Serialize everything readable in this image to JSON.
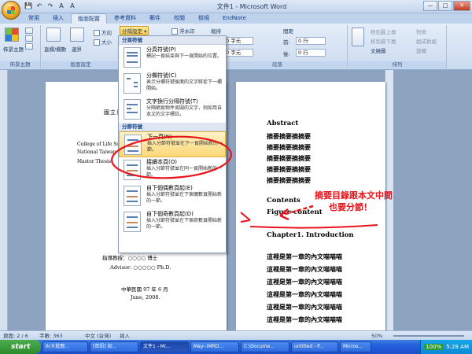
{
  "window": {
    "title": "文件1 - Microsoft Word",
    "controls": [
      "—",
      "□",
      "✕"
    ]
  },
  "quick_access": [
    "💾",
    "↶",
    "↷",
    "A",
    "A"
  ],
  "tabs": [
    "常用",
    "插入",
    "版面配置",
    "參考資料",
    "郵件",
    "校閱",
    "檢視",
    "EndNote"
  ],
  "active_tab": "版面配置",
  "ribbon": {
    "groups": {
      "theme": "佈景主題",
      "page_setup": "版面設定",
      "paragraph": "段落",
      "arrange": "排列"
    },
    "theme_button": "佈景主題",
    "margins_button": "邊界",
    "orientation_button": "方向",
    "size_button": "大小",
    "columns_button": "直欄/欄數",
    "breaks_button": "分隔設定",
    "watermark_button": "浮水印",
    "indent_label": "縮排",
    "spacing_label": "間距",
    "left_label": "左:",
    "right_label": "右:",
    "left_value": "0 字元",
    "right_value": "0 字元",
    "before_label": "前:",
    "after_label": "後:",
    "before_value": "0 行",
    "after_value": "0 行",
    "bring_front": "移到最上層",
    "send_back": "移到最下層",
    "text_wrap": "文繞圖",
    "align": "對齊",
    "group": "組成群組",
    "rotate": "旋轉"
  },
  "menu": {
    "section_page": "分頁符號",
    "section_break": "分節符號",
    "items": [
      {
        "title": "分頁符號(P)",
        "desc": "標記一頁結束與下一頁開始的位置。"
      },
      {
        "title": "分欄符號(C)",
        "desc": "表示分欄符號後面的文字將從下一欄開始。"
      },
      {
        "title": "文字換行分隔符號(T)",
        "desc": "分隔網頁物件周圍的文字，例如用自本文的文字標註。"
      },
      {
        "title": "下一頁(N)",
        "desc": "插入分節符號並在下一頁開始新的一節。"
      },
      {
        "title": "接續本頁(O)",
        "desc": "插入分節符號並在同一頁開始新的一節。"
      },
      {
        "title": "自下個偶數頁起(E)",
        "desc": "插入分節符號並在下個偶數頁開始新的一節。"
      },
      {
        "title": "自下個奇數頁起(D)",
        "desc": "插入分節符號並在下個奇數頁開始新的一節。"
      }
    ]
  },
  "left_page": {
    "university": "國立臺灣",
    "college": "College of Life Sc",
    "national": "National Taiwan",
    "thesis": "Master Thesis",
    "advisor_zh": "指導教授：○○○○ 博士",
    "advisor_en": "Advisor: ○○○○○ Ph.D.",
    "date_zh": "中華民國 97 年 6 月",
    "date_en": "June, 2008."
  },
  "right_page": {
    "abstract": "Abstract",
    "abstract_lines": [
      "摘要摘要摘摘要",
      "摘要摘要摘摘要",
      "摘要摘要摘摘要",
      "摘要摘要摘摘要",
      "摘要摘要摘摘要"
    ],
    "contents": "Contents",
    "figure_content": "Figure content",
    "chapter1": "Chapter1. Introduction",
    "chapter_lines": [
      "這裡是第一章的內文喵喵喵",
      "這裡是第一章的內文喵喵喵",
      "這裡是第一章的內文喵喵喵",
      "這裡是第一章的內文喵喵喵",
      "這裡是第一章的內文喵喵喵",
      "這裡是第一章的內文喵喵喵"
    ]
  },
  "annotation": {
    "line1": "摘要目錄跟本文中間",
    "line2": "也要分節！",
    "color": "#e8141c"
  },
  "status_bar": {
    "page": "頁面: 2 / 6",
    "words": "字數: 363",
    "language": "中文 (台灣)",
    "mode": "插入",
    "zoom": "50%"
  },
  "taskbar": {
    "start": "start",
    "buttons": [
      "6r大批閱...",
      "[資訊] 如...",
      "文件1 - Mi...",
      "May--IMRD...",
      "C:\\Docume...",
      "untitled - P...",
      "Micros..."
    ],
    "active_index": 2,
    "tray_percent": "100%",
    "clock": "5:28 AM"
  }
}
